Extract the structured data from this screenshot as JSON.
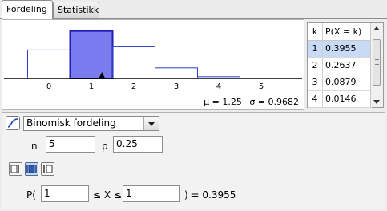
{
  "tabs": [
    {
      "label": "Fordeling",
      "active": true
    },
    {
      "label": "Statistikk",
      "active": false
    }
  ],
  "chart_data": {
    "type": "bar",
    "categories": [
      "0",
      "1",
      "2",
      "3",
      "4",
      "5"
    ],
    "values": [
      0.2373,
      0.3955,
      0.2637,
      0.0879,
      0.0146,
      0.001
    ],
    "highlighted": [
      "1"
    ],
    "xlim": [
      -1,
      6
    ],
    "xticks": [
      "0",
      "1",
      "2",
      "3",
      "4",
      "5"
    ]
  },
  "stats": {
    "mu": "μ = 1.25",
    "sigma": "σ = 0.9682"
  },
  "table": {
    "headers": {
      "k": "k",
      "p": "P(X = k)"
    },
    "rows": [
      {
        "k": "1",
        "p": "0.3955",
        "selected": true
      },
      {
        "k": "2",
        "p": "0.2637",
        "selected": false
      },
      {
        "k": "3",
        "p": "0.0879",
        "selected": false
      },
      {
        "k": "4",
        "p": "0.0146",
        "selected": false
      }
    ]
  },
  "controls": {
    "distribution": "Binomisk fordeling",
    "n_label": "n",
    "n_value": "5",
    "p_label": "p",
    "p_value": "0.25",
    "prob_open": "P(",
    "lower_value": "1",
    "mid_text": "≤ X ≤",
    "upper_value": "1",
    "result_text": ") =  0.3955"
  },
  "colors": {
    "highlight_fill": "#7b7bf0",
    "highlight_stroke": "#1f1fb0",
    "bar_stroke": "#2d3fd0",
    "selected_row": "#c7dbf7"
  }
}
